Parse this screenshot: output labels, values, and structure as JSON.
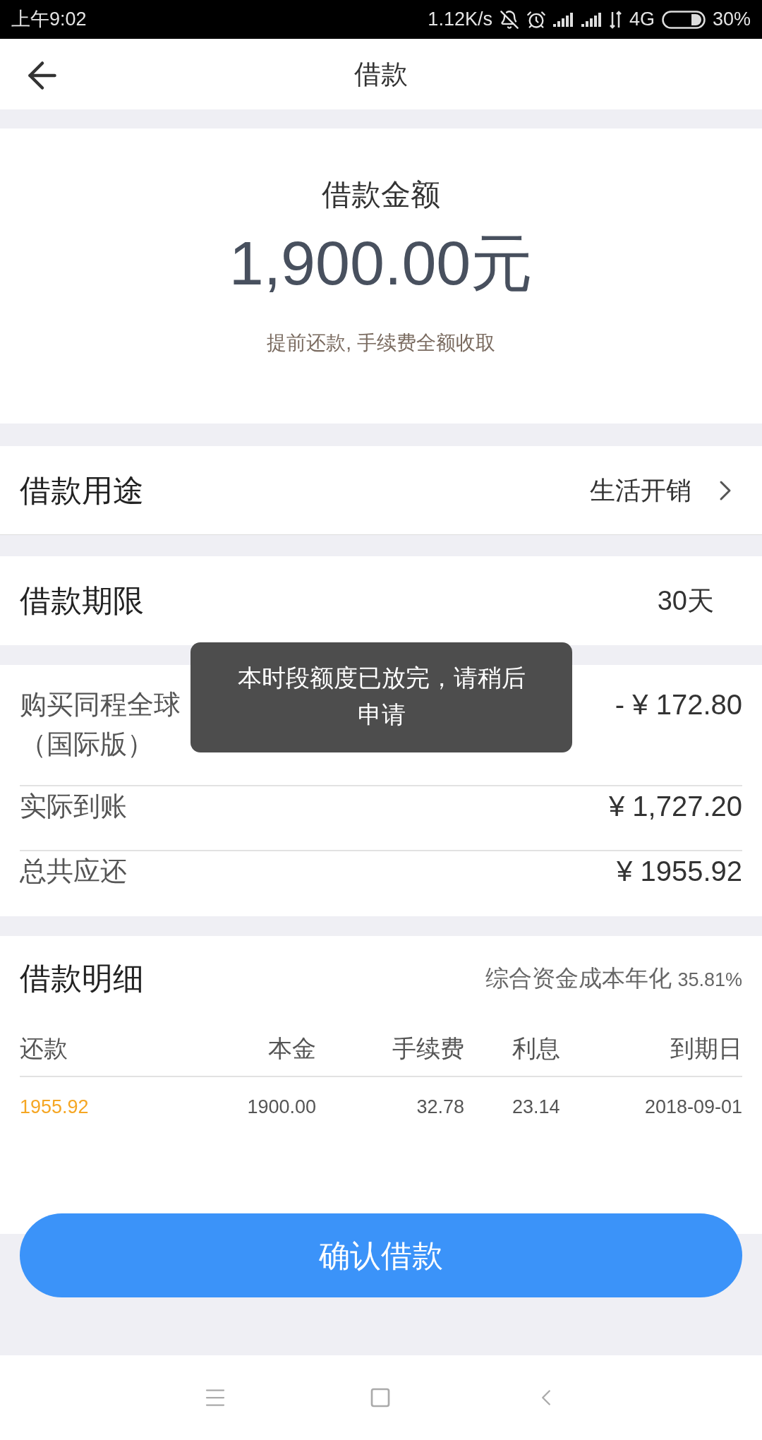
{
  "status_bar": {
    "time": "上午9:02",
    "speed": "1.12K/s",
    "network": "4G",
    "battery": "30%"
  },
  "header": {
    "title": "借款"
  },
  "amount_card": {
    "label": "借款金额",
    "amount": "1,900.00元",
    "note": "提前还款, 手续费全额收取"
  },
  "purpose": {
    "label": "借款用途",
    "value": "生活开销"
  },
  "term": {
    "label": "借款期限",
    "value": "30天"
  },
  "summary": [
    {
      "label": "购买同程全球",
      "label_line_2": "（国际版）",
      "value": "- ¥ 172.80"
    },
    {
      "label": "实际到账",
      "value": "¥ 1,727.20"
    },
    {
      "label": "总共应还",
      "value": "¥ 1955.92"
    }
  ],
  "details": {
    "title": "借款明细",
    "rate_label": "综合资金成本年化",
    "rate": "35.81%",
    "columns": [
      "还款",
      "本金",
      "手续费",
      "利息",
      "到期日"
    ],
    "rows": [
      [
        "1955.92",
        "1900.00",
        "32.78",
        "23.14",
        "2018-09-01"
      ]
    ]
  },
  "confirm_button": "确认借款",
  "toast": "本时段额度已放完，请稍后申请"
}
